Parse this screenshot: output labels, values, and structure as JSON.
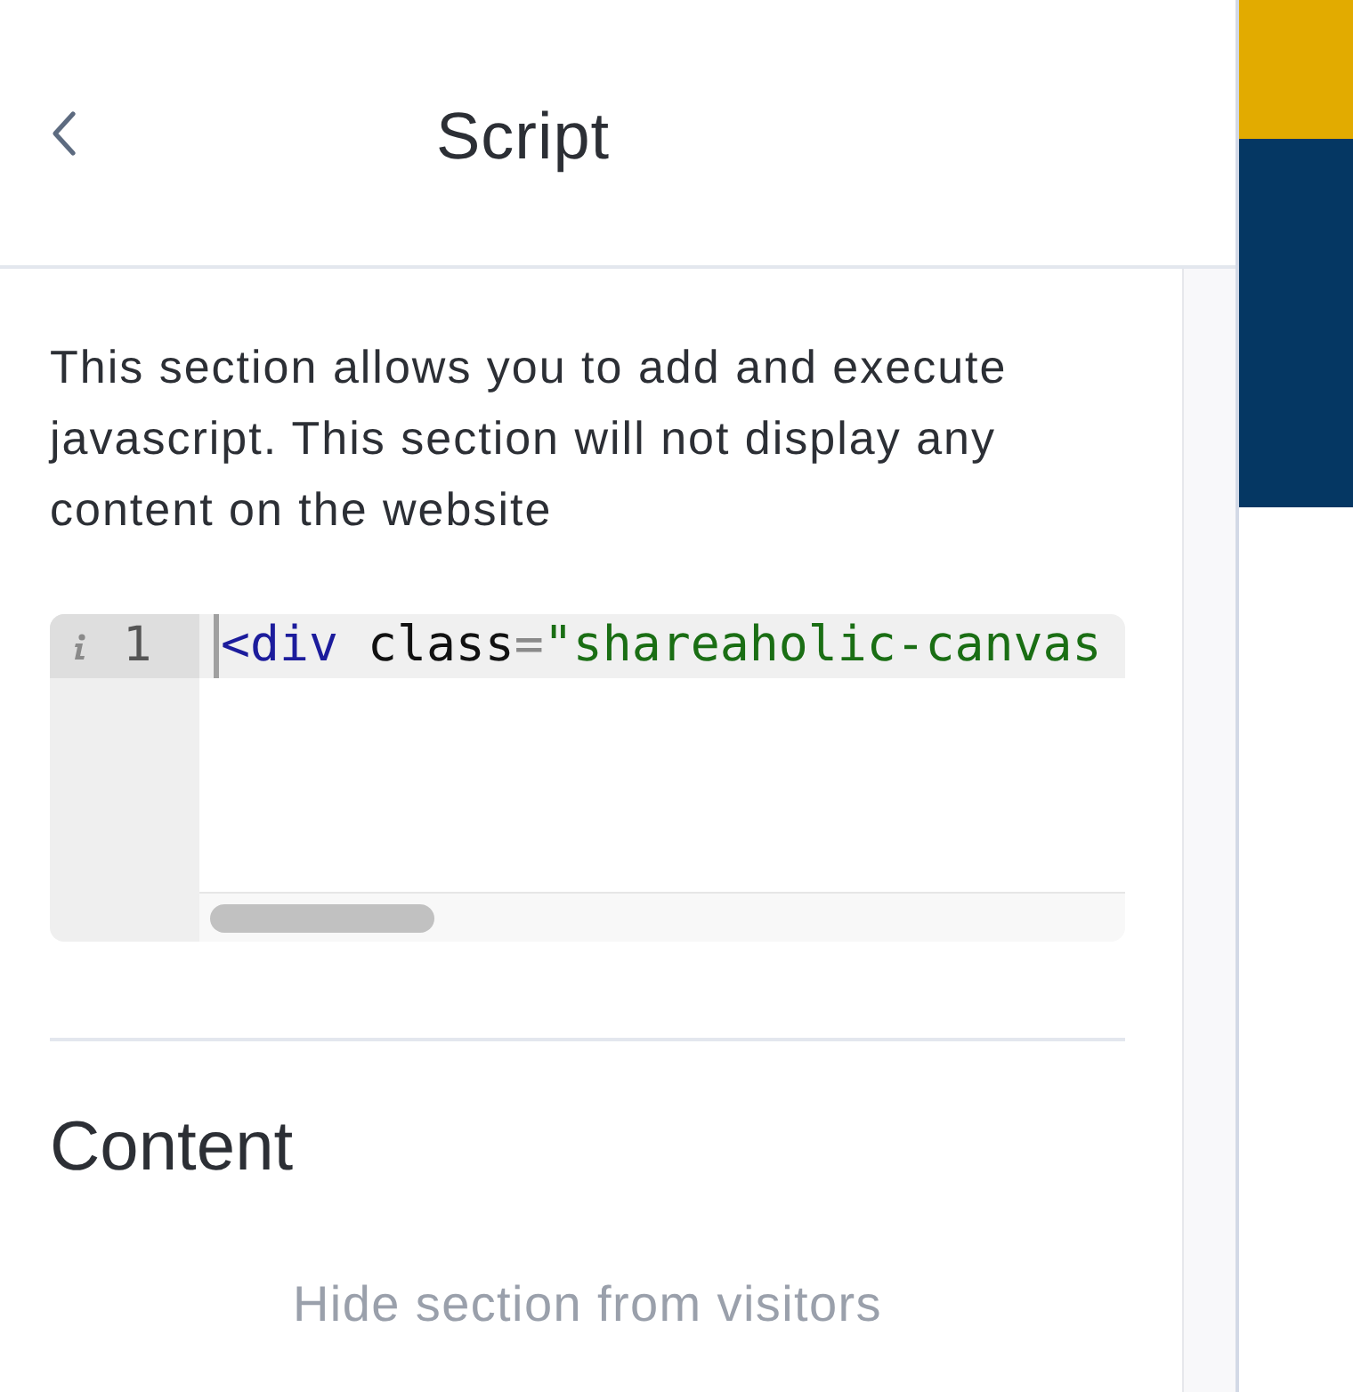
{
  "header": {
    "title": "Script"
  },
  "description": "This section allows you to add and execute javascript. This section will not display any content on the website",
  "code_editor": {
    "lines": [
      {
        "number": "1",
        "info_marker": true,
        "active": true,
        "tokens": [
          {
            "kind": "tag",
            "text": "<div"
          },
          {
            "kind": "plain",
            "text": " class"
          },
          {
            "kind": "operator",
            "text": "="
          },
          {
            "kind": "string",
            "text": "\"shareaholic-canvas"
          }
        ]
      }
    ]
  },
  "content_section": {
    "title": "Content",
    "hide_link": "Hide section from visitors"
  }
}
